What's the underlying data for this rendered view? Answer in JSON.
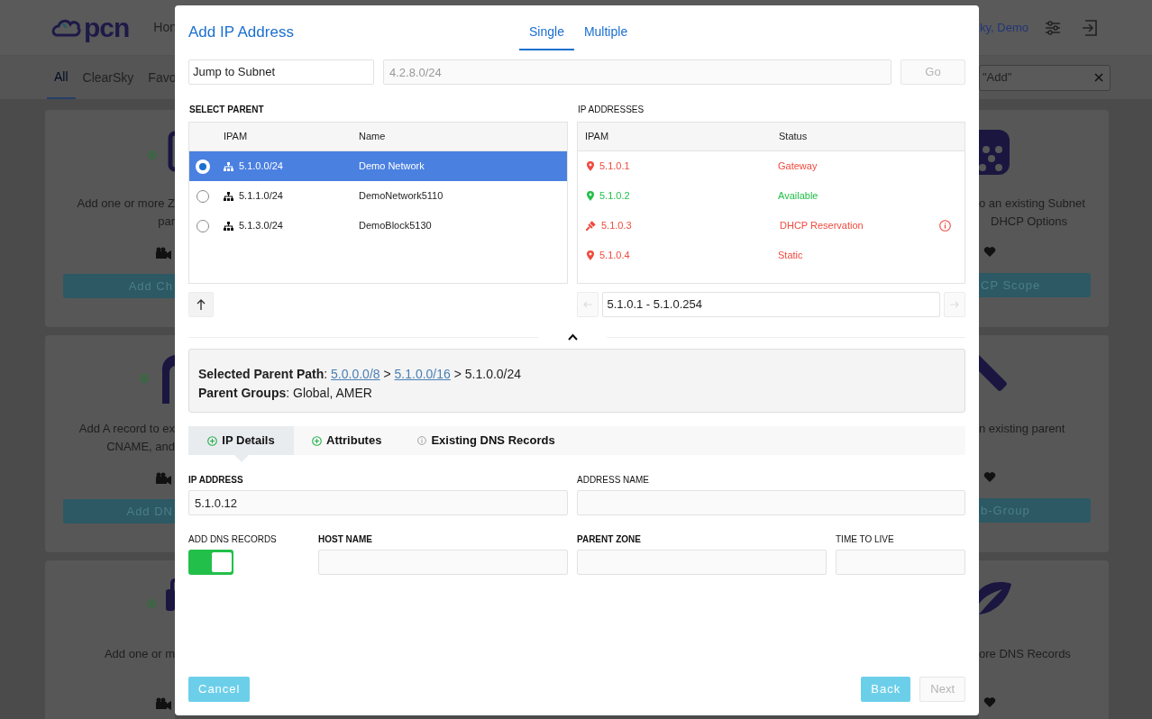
{
  "background": {
    "logo": "pcn",
    "nav_item": "Hon",
    "user": "ky, Demo",
    "tabs": [
      {
        "label": "All",
        "selected": true
      },
      {
        "label": "ClearSky",
        "selected": false
      },
      {
        "label": "Favo",
        "selected": false
      }
    ],
    "search": {
      "value": "\"Add\""
    },
    "cards_left": [
      {
        "lines": [
          "Add one or more Z",
          "par"
        ],
        "button": "Add Ch"
      },
      {
        "lines": [
          "Add A record to ex",
          "CNAME, and"
        ],
        "button": "Add DN"
      },
      {
        "lines": [
          "Add one or m"
        ]
      }
    ],
    "cards_right": [
      {
        "lines": [
          "o an existing Subnet",
          "DHCP Options"
        ],
        "button": "CP Scope"
      },
      {
        "lines": [
          "n existing parent"
        ],
        "button": "b-Group"
      },
      {
        "lines": [
          "ore DNS Records"
        ]
      }
    ]
  },
  "modal": {
    "title": "Add IP Address",
    "modes": [
      {
        "label": "Single",
        "selected": true
      },
      {
        "label": "Multiple",
        "selected": false
      }
    ],
    "jump": {
      "value": "Jump to Subnet"
    },
    "subnet": {
      "placeholder": "4.2.8.0/24"
    },
    "go": {
      "label": "Go",
      "disabled": true
    },
    "parents": {
      "title": "SELECT PARENT",
      "required": true,
      "columns": [
        "IPAM",
        "Name"
      ],
      "rows": [
        {
          "ipam": "5.1.0.0/24",
          "name": "Demo Network",
          "selected": true
        },
        {
          "ipam": "5.1.1.0/24",
          "name": "DemoNetwork5110",
          "selected": false
        },
        {
          "ipam": "5.1.3.0/24",
          "name": "DemoBlock5130",
          "selected": false
        }
      ]
    },
    "addresses": {
      "title": "IP ADDRESSES",
      "required": false,
      "columns": [
        "IPAM",
        "Status"
      ],
      "rows": [
        {
          "ipam": "5.1.0.1",
          "status": "Gateway",
          "color": "#f04a3e",
          "kind": "pin",
          "info": false
        },
        {
          "ipam": "5.1.0.2",
          "status": "Available",
          "color": "#23c04a",
          "kind": "pin",
          "info": false
        },
        {
          "ipam": "5.1.0.3",
          "status": "DHCP Reservation",
          "color": "#f04a3e",
          "kind": "pushpin",
          "info": true
        },
        {
          "ipam": "5.1.0.4",
          "status": "Static",
          "color": "#f04a3e",
          "kind": "pin",
          "info": false
        }
      ],
      "range": "5.1.0.1 - 5.1.0.254"
    },
    "path": {
      "label": "**Selected Parent Path**:",
      "links": [
        "5.0.0.0/8",
        "5.1.0.0/16"
      ],
      "separator": ">",
      "current": "5.1.0.0/24"
    },
    "groups": "**Parent Groups**: Global, AMER",
    "detail_tabs": [
      {
        "label": "IP Details",
        "kind": "add",
        "selected": true
      },
      {
        "label": "Attributes",
        "kind": "add",
        "selected": false
      },
      {
        "label": "Existing DNS Records",
        "kind": "info",
        "selected": false
      }
    ],
    "ip_address": {
      "label": "IP ADDRESS",
      "required": true,
      "value": "5.1.0.12"
    },
    "address_name": {
      "label": "ADDRESS NAME",
      "required": false
    },
    "add_dns": {
      "label": "ADD DNS RECORDS",
      "required": false,
      "on": true
    },
    "host_name": {
      "label": "HOST NAME",
      "required": true
    },
    "parent_zone": {
      "label": "PARENT ZONE",
      "required": true
    },
    "ttl": {
      "label": "TIME TO LIVE",
      "required": false
    },
    "buttons": {
      "cancel": "Cancel",
      "back": "Back",
      "next": {
        "label": "Next",
        "disabled": true
      }
    }
  }
}
